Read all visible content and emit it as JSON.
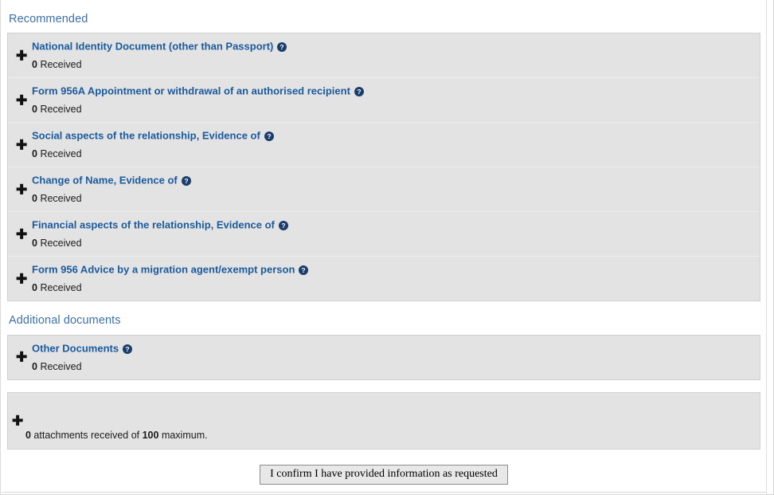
{
  "colors": {
    "section_header": "#3d6fa5",
    "doc_title": "#1b5a9c",
    "help_icon": "#1b3d6d",
    "panel_bg": "#e3e3e3",
    "panel_border": "#d0d0d0",
    "page_bg": "#ffffff",
    "button_bg": "#e8e8e8",
    "button_border": "#8c8c8c",
    "text": "#1a1a1a"
  },
  "sections": [
    {
      "id": "recommended",
      "header": "Recommended",
      "items": [
        {
          "title": "National Identity Document (other than Passport)",
          "help_icon": "help-circle-icon",
          "expand_icon": "plus-icon",
          "count": "0",
          "count_label": "Received"
        },
        {
          "title": "Form 956A Appointment or withdrawal of an authorised recipient",
          "help_icon": "help-circle-icon",
          "expand_icon": "plus-icon",
          "count": "0",
          "count_label": "Received"
        },
        {
          "title": "Social aspects of the relationship, Evidence of",
          "help_icon": "help-circle-icon",
          "expand_icon": "plus-icon",
          "count": "0",
          "count_label": "Received"
        },
        {
          "title": "Change of Name, Evidence of",
          "help_icon": "help-circle-icon",
          "expand_icon": "plus-icon",
          "count": "0",
          "count_label": "Received"
        },
        {
          "title": "Financial aspects of the relationship, Evidence of",
          "help_icon": "help-circle-icon",
          "expand_icon": "plus-icon",
          "count": "0",
          "count_label": "Received"
        },
        {
          "title": "Form 956 Advice by a migration agent/exempt person",
          "help_icon": "help-circle-icon",
          "expand_icon": "plus-icon",
          "count": "0",
          "count_label": "Received"
        }
      ]
    },
    {
      "id": "additional-documents",
      "header": "Additional documents",
      "items": [
        {
          "title": "Other Documents",
          "help_icon": "help-circle-icon",
          "expand_icon": "plus-icon",
          "count": "0",
          "count_label": "Received"
        }
      ]
    }
  ],
  "attachments": {
    "expand_icon": "plus-icon",
    "title_redacted": true,
    "caption_count": "0",
    "caption_middle": " attachments received of ",
    "caption_max": "100",
    "caption_end": " maximum."
  },
  "confirm_button": {
    "label": "I confirm I have provided information as requested"
  }
}
